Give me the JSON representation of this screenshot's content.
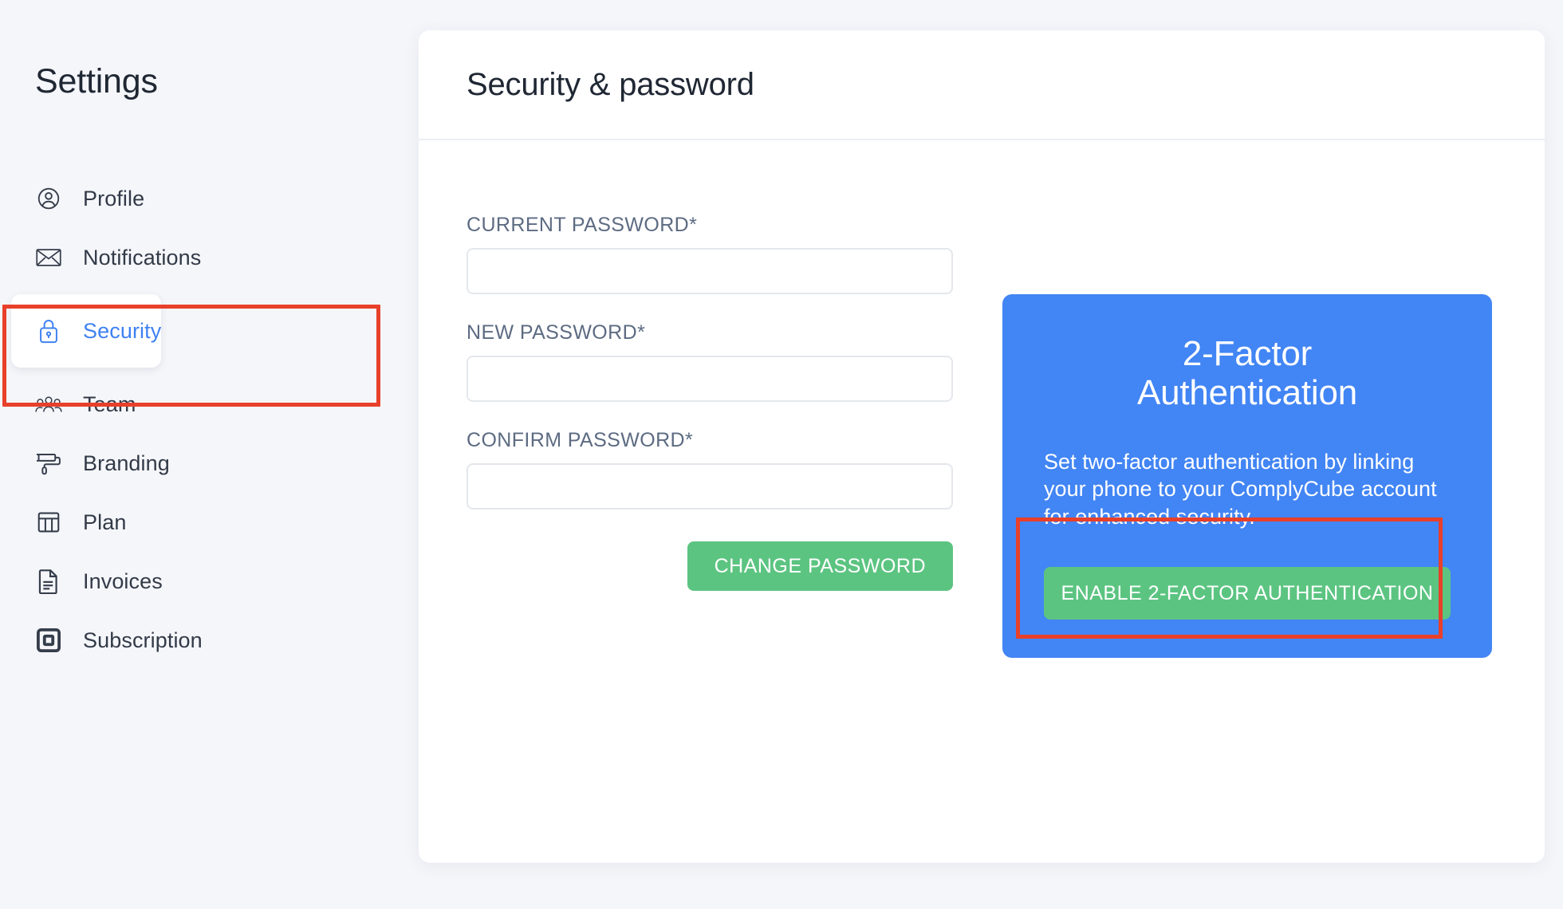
{
  "sidebar": {
    "title": "Settings",
    "items": [
      {
        "label": "Profile",
        "icon": "user-circle-icon",
        "active": false
      },
      {
        "label": "Notifications",
        "icon": "envelope-icon",
        "active": false
      },
      {
        "label": "Security",
        "icon": "lock-icon",
        "active": true
      },
      {
        "label": "Team",
        "icon": "people-icon",
        "active": false
      },
      {
        "label": "Branding",
        "icon": "paint-roller-icon",
        "active": false
      },
      {
        "label": "Plan",
        "icon": "table-icon",
        "active": false
      },
      {
        "label": "Invoices",
        "icon": "document-icon",
        "active": false
      },
      {
        "label": "Subscription",
        "icon": "square-card-icon",
        "active": false
      }
    ]
  },
  "main": {
    "page_title": "Security & password",
    "form": {
      "fields": [
        {
          "label": "CURRENT PASSWORD*",
          "value": "",
          "placeholder": ""
        },
        {
          "label": "NEW PASSWORD*",
          "value": "",
          "placeholder": ""
        },
        {
          "label": "CONFIRM PASSWORD*",
          "value": "",
          "placeholder": ""
        }
      ],
      "submit_label": "CHANGE PASSWORD"
    },
    "twofa": {
      "title_line1": "2-Factor",
      "title_line2": "Authentication",
      "description": "Set two-factor authentication by linking your phone to your ComplyCube account for enhanced security.",
      "button_label": "ENABLE 2-FACTOR AUTHENTICATION"
    }
  },
  "colors": {
    "page_background": "#F5F6FA",
    "accent_blue": "#4285F4",
    "active_link_blue": "#3F82F2",
    "button_green": "#5CC481",
    "annotation_red": "#E8402A",
    "text_dark": "#1F2733",
    "label_gray": "#5D6B82"
  },
  "annotations": [
    {
      "name": "security-nav-highlight"
    },
    {
      "name": "enable-2fa-highlight"
    }
  ]
}
